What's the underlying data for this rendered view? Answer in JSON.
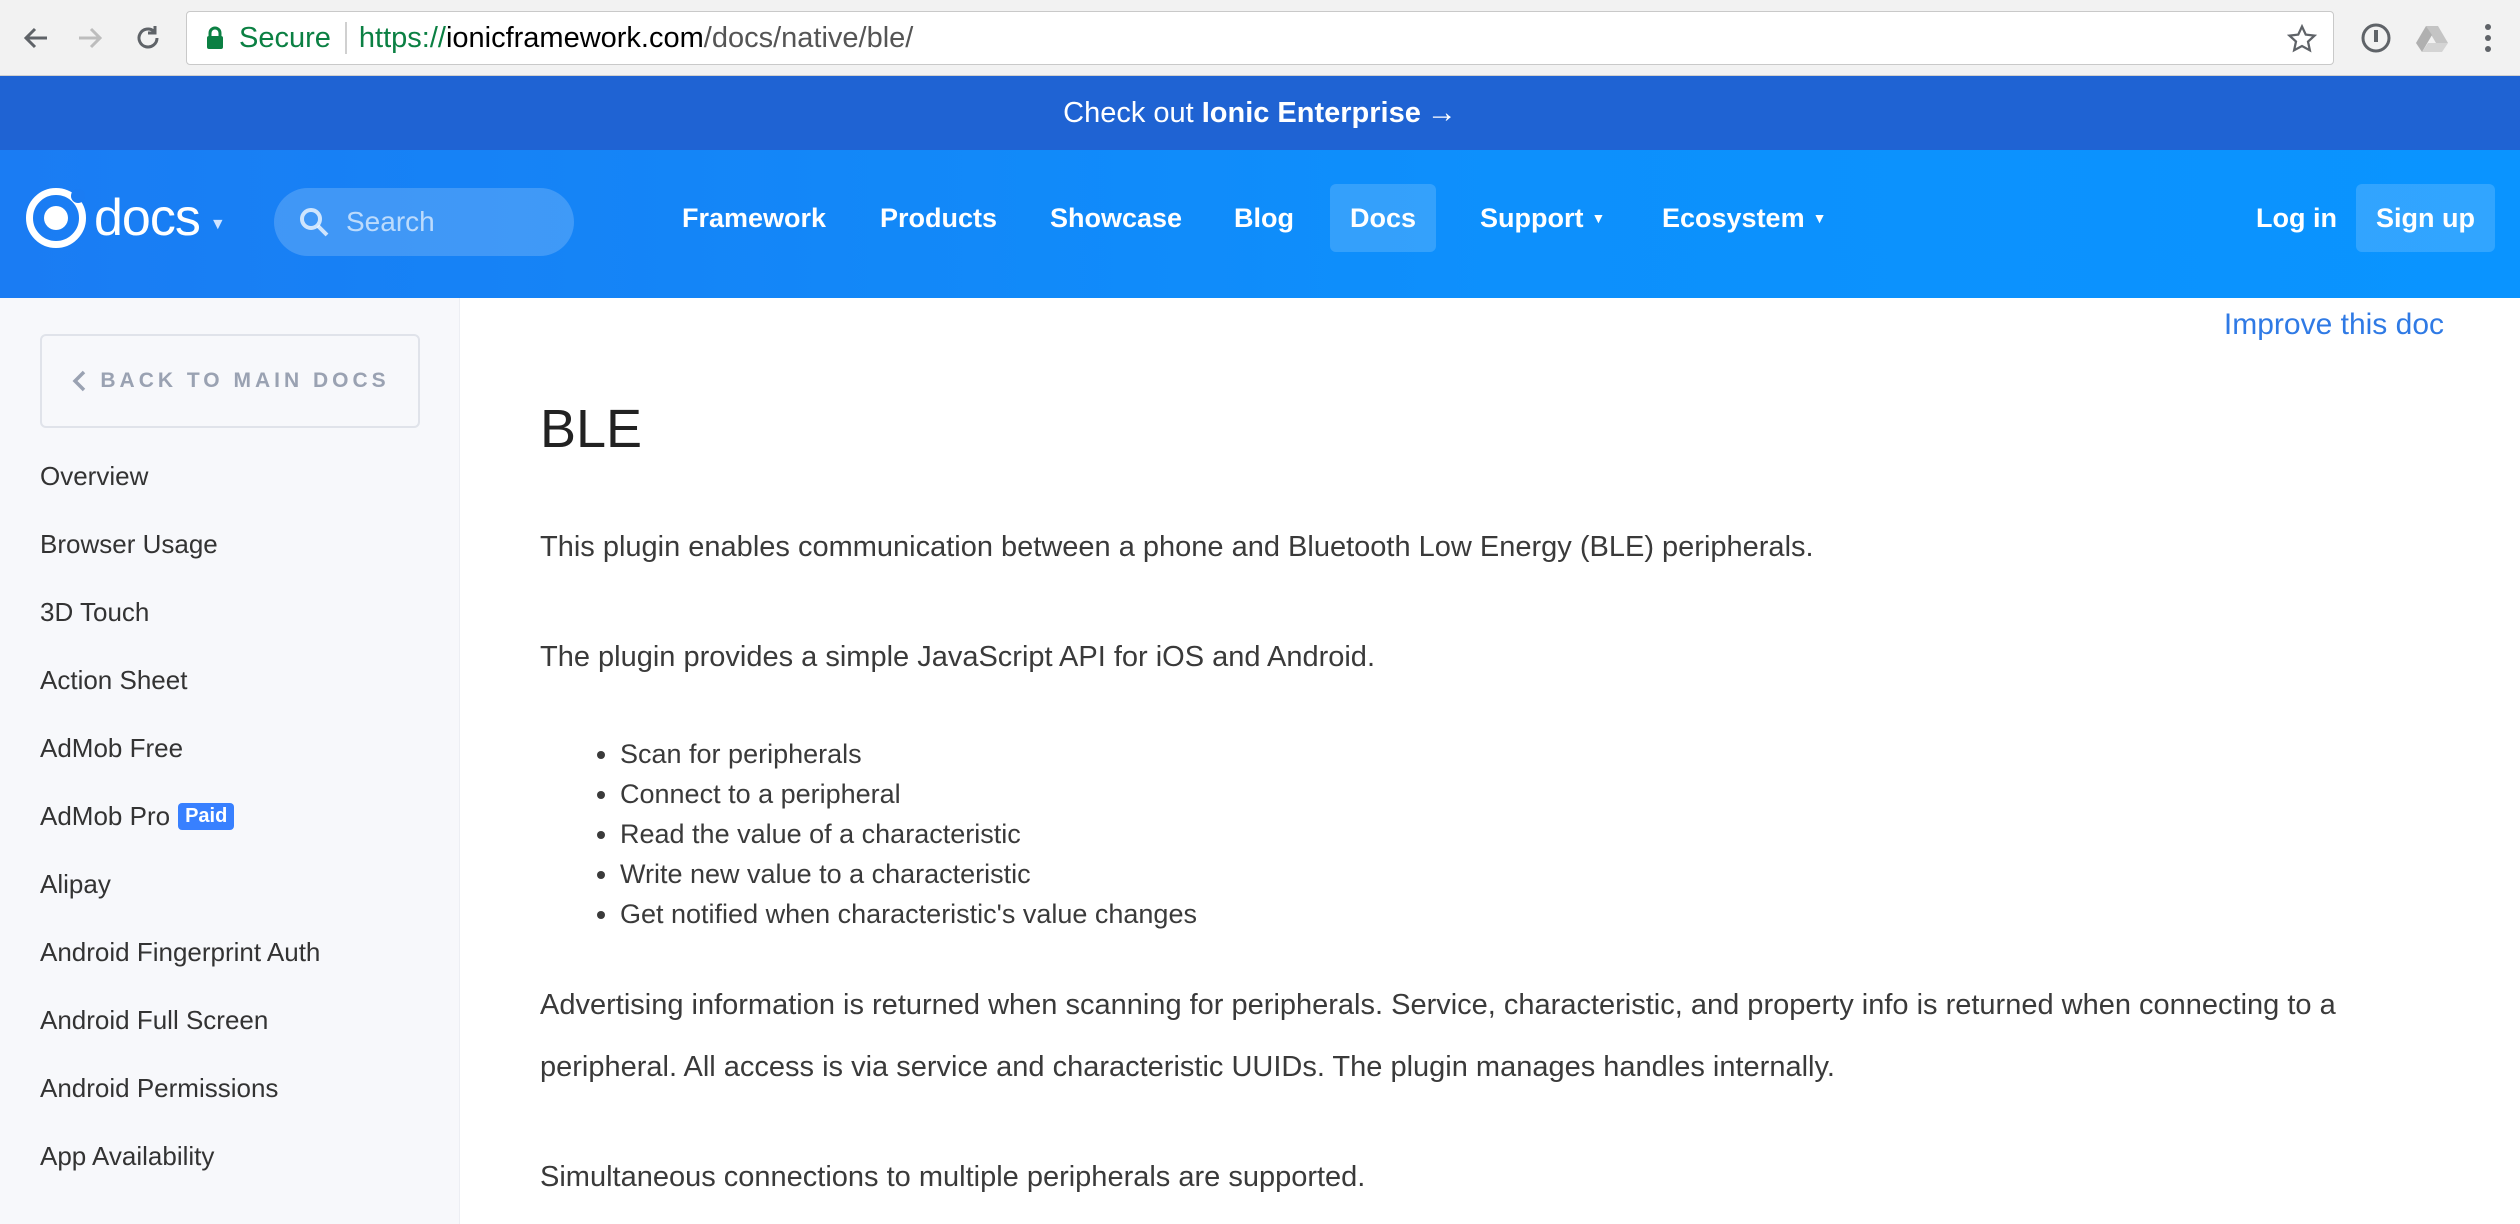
{
  "browser": {
    "secure_label": "Secure",
    "url_scheme": "https://",
    "url_host": "ionicframework.com",
    "url_path": "/docs/native/ble/"
  },
  "banner": {
    "prefix": "Check out",
    "highlight": "Ionic Enterprise",
    "arrow": "→"
  },
  "nav": {
    "logo_text": "docs",
    "search_placeholder": "Search",
    "items": [
      {
        "label": "Framework"
      },
      {
        "label": "Products"
      },
      {
        "label": "Showcase"
      },
      {
        "label": "Blog"
      },
      {
        "label": "Docs",
        "active": true
      },
      {
        "label": "Support",
        "dropdown": true
      },
      {
        "label": "Ecosystem",
        "dropdown": true
      }
    ],
    "login": "Log in",
    "signup": "Sign up"
  },
  "sidebar": {
    "back_label": "BACK TO MAIN DOCS",
    "items": [
      {
        "label": "Overview"
      },
      {
        "label": "Browser Usage"
      },
      {
        "label": "3D Touch"
      },
      {
        "label": "Action Sheet"
      },
      {
        "label": "AdMob Free"
      },
      {
        "label": "AdMob Pro",
        "badge": "Paid"
      },
      {
        "label": "Alipay"
      },
      {
        "label": "Android Fingerprint Auth"
      },
      {
        "label": "Android Full Screen"
      },
      {
        "label": "Android Permissions"
      },
      {
        "label": "App Availability"
      }
    ]
  },
  "content": {
    "improve_link": "Improve this doc",
    "title": "BLE",
    "intro": "This plugin enables communication between a phone and Bluetooth Low Energy (BLE) peripherals.",
    "api": "The plugin provides a simple JavaScript API for iOS and Android.",
    "features": [
      "Scan for peripherals",
      "Connect to a peripheral",
      "Read the value of a characteristic",
      "Write new value to a characteristic",
      "Get notified when characteristic's value changes"
    ],
    "advertising": "Advertising information is returned when scanning for peripherals. Service, characteristic, and property info is returned when connecting to a peripheral. All access is via service and characteristic UUIDs. The plugin manages handles internally.",
    "simultaneous": "Simultaneous connections to multiple peripherals are supported."
  },
  "colors": {
    "banner": "#1f63d3",
    "nav_gradient_start": "#1a7cf3",
    "nav_gradient_end": "#0a94ff",
    "link": "#2f7ae5",
    "badge": "#3880ff",
    "secure_green": "#0b8043"
  }
}
